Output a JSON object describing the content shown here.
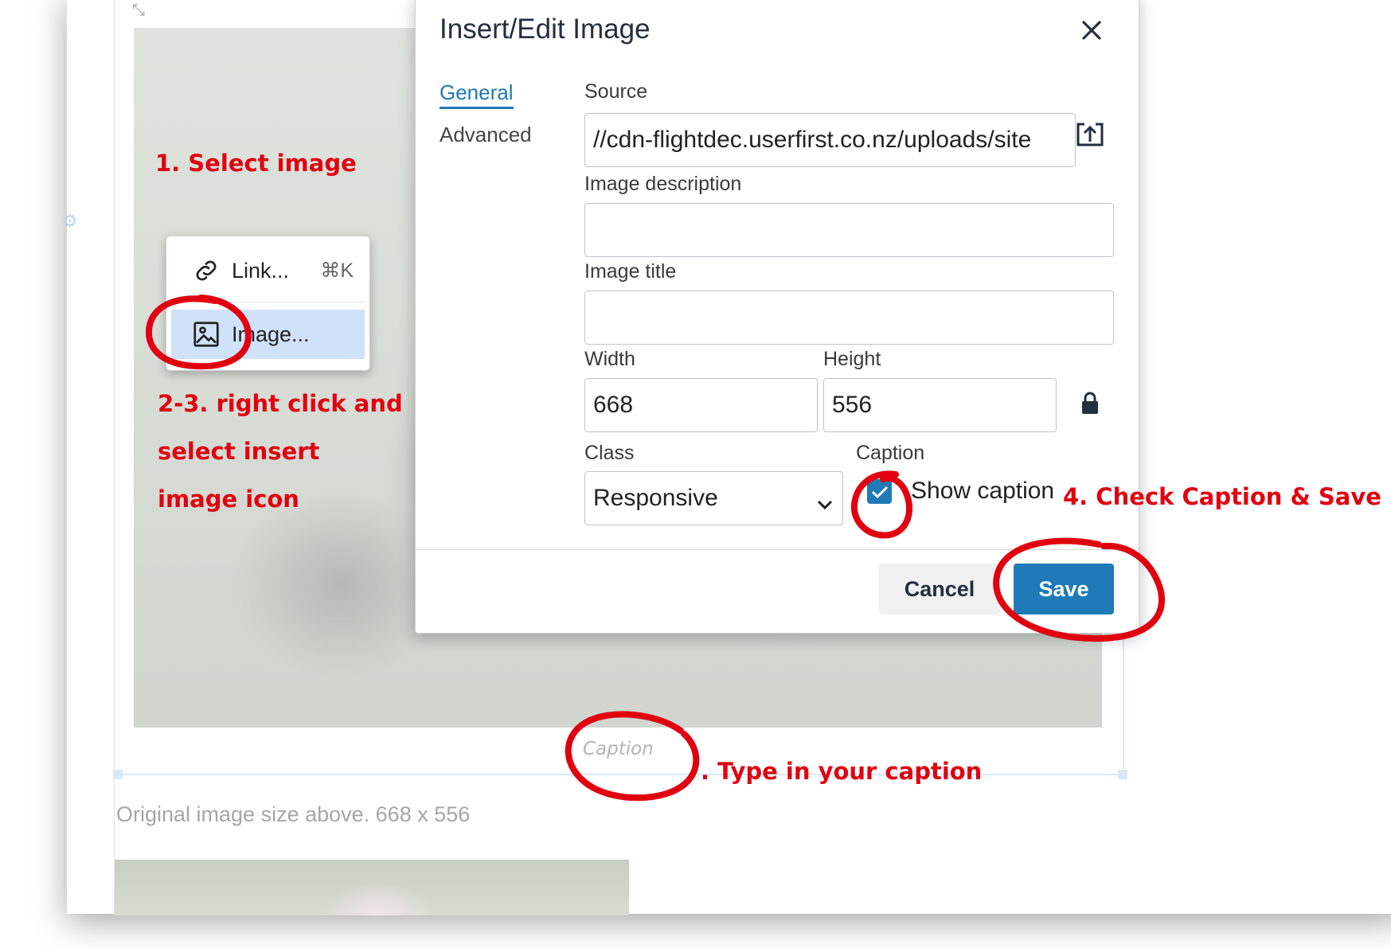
{
  "editor": {
    "caption_placeholder": "Caption",
    "original_size_note": "Original image size above.  668 x 556"
  },
  "context_menu": {
    "items": [
      {
        "label": "Link...",
        "shortcut": "⌘K",
        "icon": "link-icon"
      },
      {
        "label": "Image...",
        "icon": "image-icon"
      }
    ]
  },
  "dialog": {
    "title": "Insert/Edit Image",
    "tabs": [
      "General",
      "Advanced"
    ],
    "source": {
      "label": "Source",
      "value": "//cdn-flightdec.userfirst.co.nz/uploads/site"
    },
    "image_description": {
      "label": "Image description",
      "value": ""
    },
    "image_title": {
      "label": "Image title",
      "value": ""
    },
    "width": {
      "label": "Width",
      "value": "668"
    },
    "height": {
      "label": "Height",
      "value": "556"
    },
    "class": {
      "label": "Class",
      "value": "Responsive"
    },
    "caption": {
      "label": "Caption",
      "checkbox_label": "Show caption",
      "checked": true
    },
    "buttons": {
      "cancel": "Cancel",
      "save": "Save"
    }
  },
  "annotations": {
    "step1": "1. Select image",
    "step23_line1": "2-3. right click and",
    "step23_line2": "select insert",
    "step23_line3": "image icon",
    "step4": "4. Check Caption & Save",
    "step5": ". Type in your caption"
  },
  "colors": {
    "accent": "#207ab7",
    "annotation": "#e1000f",
    "menu_highlight": "#cfe2fa"
  }
}
